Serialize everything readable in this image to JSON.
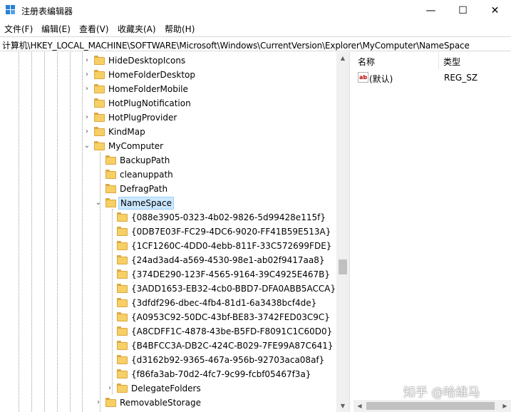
{
  "window": {
    "title": "注册表编辑器",
    "minimize_glyph": "—",
    "maximize_glyph": "☐",
    "close_glyph": "✕"
  },
  "menu": [
    "文件(F)",
    "编辑(E)",
    "查看(V)",
    "收藏夹(A)",
    "帮助(H)"
  ],
  "address": "计算机\\HKEY_LOCAL_MACHINE\\SOFTWARE\\Microsoft\\Windows\\CurrentVersion\\Explorer\\MyComputer\\NameSpace",
  "tree": [
    {
      "label": "HideDesktopIcons",
      "depth": 0,
      "expander": "›"
    },
    {
      "label": "HomeFolderDesktop",
      "depth": 0,
      "expander": "›"
    },
    {
      "label": "HomeFolderMobile",
      "depth": 0,
      "expander": "›"
    },
    {
      "label": "HotPlugNotification",
      "depth": 0,
      "expander": ""
    },
    {
      "label": "HotPlugProvider",
      "depth": 0,
      "expander": "›"
    },
    {
      "label": "KindMap",
      "depth": 0,
      "expander": "›"
    },
    {
      "label": "MyComputer",
      "depth": 0,
      "expander": "⌄"
    },
    {
      "label": "BackupPath",
      "depth": 1,
      "expander": ""
    },
    {
      "label": "cleanuppath",
      "depth": 1,
      "expander": ""
    },
    {
      "label": "DefragPath",
      "depth": 1,
      "expander": ""
    },
    {
      "label": "NameSpace",
      "depth": 1,
      "expander": "⌄",
      "selected": true
    },
    {
      "label": "{088e3905-0323-4b02-9826-5d99428e115f}",
      "depth": 2,
      "expander": ""
    },
    {
      "label": "{0DB7E03F-FC29-4DC6-9020-FF41B59E513A}",
      "depth": 2,
      "expander": ""
    },
    {
      "label": "{1CF1260C-4DD0-4ebb-811F-33C572699FDE}",
      "depth": 2,
      "expander": ""
    },
    {
      "label": "{24ad3ad4-a569-4530-98e1-ab02f9417aa8}",
      "depth": 2,
      "expander": ""
    },
    {
      "label": "{374DE290-123F-4565-9164-39C4925E467B}",
      "depth": 2,
      "expander": ""
    },
    {
      "label": "{3ADD1653-EB32-4cb0-BBD7-DFA0ABB5ACCA}",
      "depth": 2,
      "expander": ""
    },
    {
      "label": "{3dfdf296-dbec-4fb4-81d1-6a3438bcf4de}",
      "depth": 2,
      "expander": ""
    },
    {
      "label": "{A0953C92-50DC-43bf-BE83-3742FED03C9C}",
      "depth": 2,
      "expander": ""
    },
    {
      "label": "{A8CDFF1C-4878-43be-B5FD-F8091C1C60D0}",
      "depth": 2,
      "expander": ""
    },
    {
      "label": "{B4BFCC3A-DB2C-424C-B029-7FE99A87C641}",
      "depth": 2,
      "expander": ""
    },
    {
      "label": "{d3162b92-9365-467a-956b-92703aca08af}",
      "depth": 2,
      "expander": ""
    },
    {
      "label": "{f86fa3ab-70d2-4fc7-9c99-fcbf05467f3a}",
      "depth": 2,
      "expander": ""
    },
    {
      "label": "DelegateFolders",
      "depth": 2,
      "expander": "›"
    },
    {
      "label": "RemovableStorage",
      "depth": 1,
      "expander": "›"
    }
  ],
  "list": {
    "columns": {
      "name": "名称",
      "type": "类型"
    },
    "rows": [
      {
        "icon": "ab",
        "name": "(默认)",
        "type": "REG_SZ"
      }
    ]
  },
  "scroll": {
    "up": "▲",
    "down": "▼",
    "left": "◀",
    "right": "▶"
  },
  "watermark": "知乎 @哈维马",
  "colors": {
    "selection_bg": "#cce8ff",
    "folder_yellow": "#f6cf65"
  }
}
